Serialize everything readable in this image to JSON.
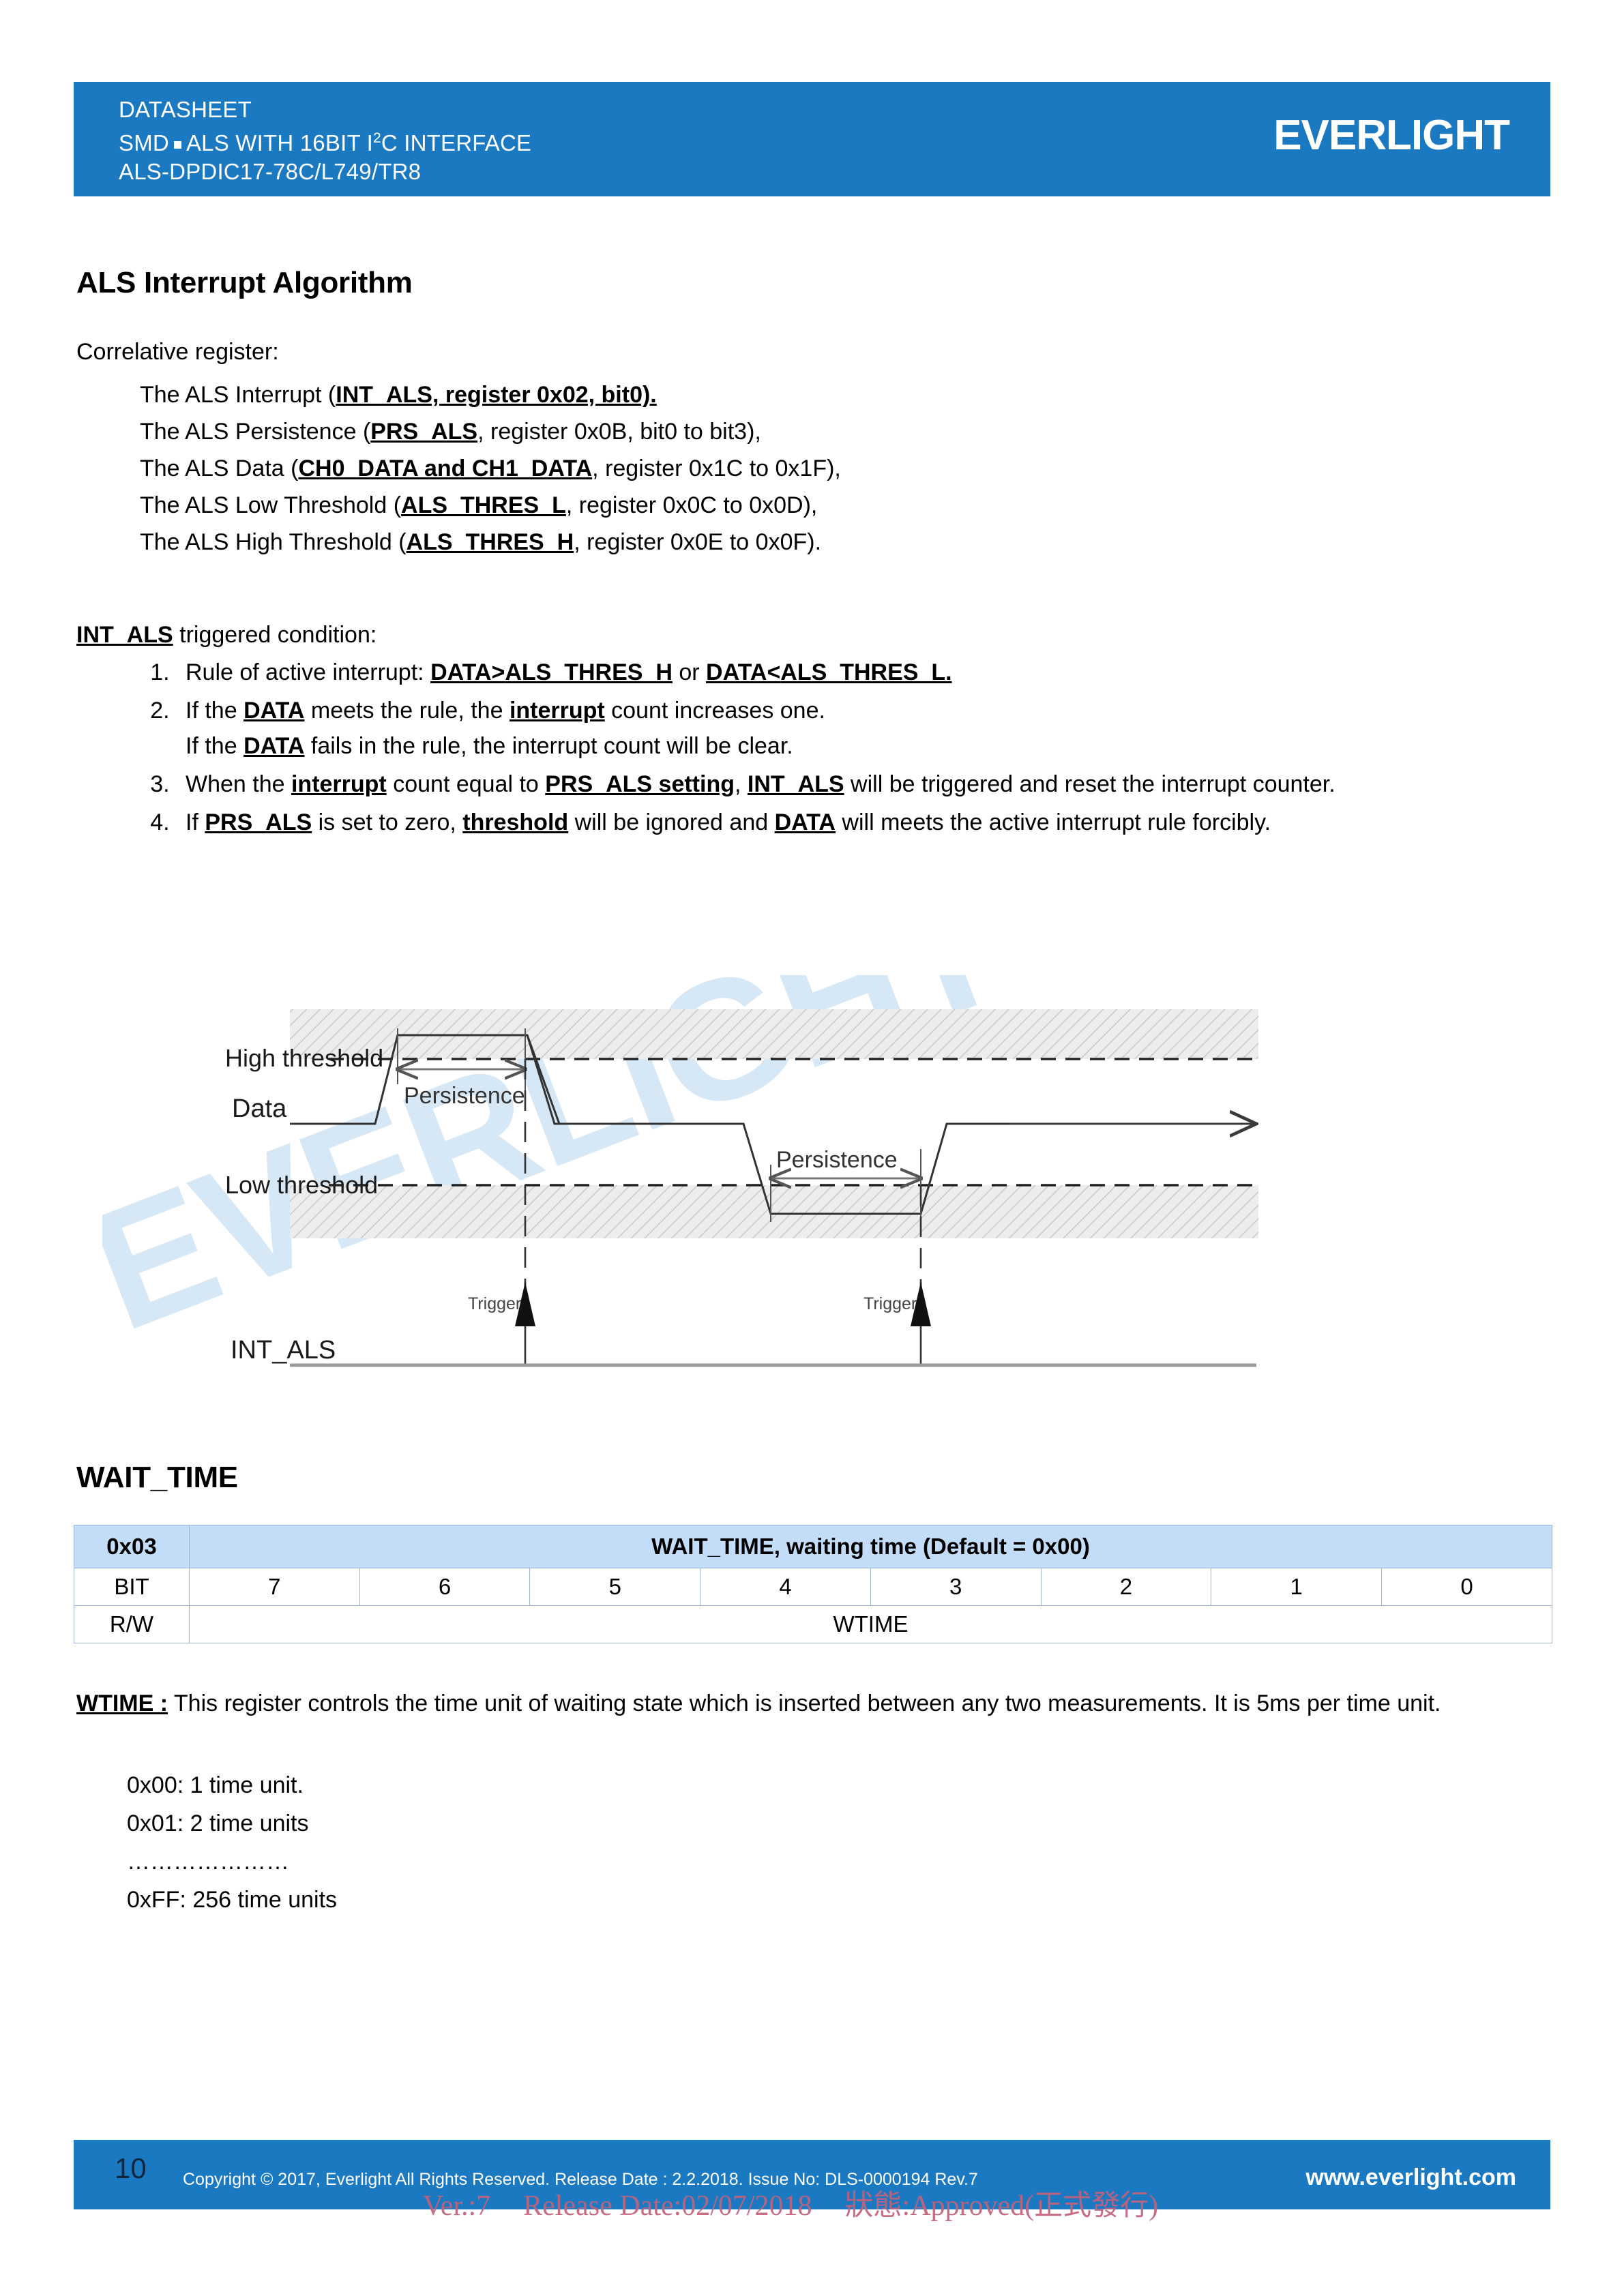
{
  "header": {
    "line1": "DATASHEET",
    "line2_pre": "SMD",
    "line2_mid": "ALS WITH 16BIT I",
    "line2_sup": "2",
    "line2_post": "C INTERFACE",
    "line3": "ALS-DPDIC17-78C/L749/TR8",
    "brand": "EVERLIGHT",
    "bar_color": "#1b79c2"
  },
  "body": {
    "als_section_title": "ALS Interrupt Algorithm",
    "correlative_label": "Correlative register:",
    "registers": [
      {
        "prefix": "The ALS Interrupt (",
        "bold": "INT_ALS, register 0x02, bit0).",
        "suffix": ""
      },
      {
        "prefix": "The ALS Persistence (",
        "bold": "PRS_ALS",
        "suffix": ", register 0x0B, bit0 to bit3),"
      },
      {
        "prefix": "The ALS Data (",
        "bold": "CH0_DATA and CH1_DATA",
        "suffix": ", register 0x1C to 0x1F),"
      },
      {
        "prefix": "The ALS Low Threshold (",
        "bold": "ALS_THRES_L",
        "suffix": ", register 0x0C to 0x0D),"
      },
      {
        "prefix": "The ALS High Threshold (",
        "bold": "ALS_THRES_H",
        "suffix": ", register 0x0E to 0x0F)."
      }
    ],
    "triggered_condition_bold": "INT_ALS",
    "triggered_condition_rest": " triggered condition:",
    "rules": [
      {
        "parts": [
          {
            "t": "Rule of active interrupt: ",
            "s": "plain"
          },
          {
            "t": "DATA",
            "s": "bu"
          },
          {
            "t": ">",
            "s": "bu"
          },
          {
            "t": "ALS_THRES_H",
            "s": "bu"
          },
          {
            "t": " or ",
            "s": "plain"
          },
          {
            "t": "DATA",
            "s": "bu"
          },
          {
            "t": "<",
            "s": "bu"
          },
          {
            "t": "ALS_THRES_L.",
            "s": "bu"
          }
        ]
      },
      {
        "parts": [
          {
            "t": "If the ",
            "s": "plain"
          },
          {
            "t": "DATA",
            "s": "bu"
          },
          {
            "t": " meets the rule, the ",
            "s": "plain"
          },
          {
            "t": "interrupt",
            "s": "bu"
          },
          {
            "t": " count increases one.",
            "s": "plain"
          },
          {
            "t": "BR",
            "s": "br"
          },
          {
            "t": "If the ",
            "s": "plain"
          },
          {
            "t": "DATA",
            "s": "bu"
          },
          {
            "t": " fails in the rule, the interrupt count will be clear.",
            "s": "plain"
          }
        ]
      },
      {
        "parts": [
          {
            "t": "When the ",
            "s": "plain"
          },
          {
            "t": "interrupt",
            "s": "bu"
          },
          {
            "t": " count equal to ",
            "s": "plain"
          },
          {
            "t": "PRS_ALS setting",
            "s": "bu"
          },
          {
            "t": ", ",
            "s": "plain"
          },
          {
            "t": "INT_ALS",
            "s": "bu"
          },
          {
            "t": " will be triggered and reset the interrupt counter.",
            "s": "plain"
          }
        ]
      },
      {
        "parts": [
          {
            "t": "If ",
            "s": "plain"
          },
          {
            "t": "PRS_ALS",
            "s": "bu"
          },
          {
            "t": " is set to zero, ",
            "s": "plain"
          },
          {
            "t": "threshold",
            "s": "bu"
          },
          {
            "t": " will be ignored and ",
            "s": "plain"
          },
          {
            "t": "DATA",
            "s": "bu"
          },
          {
            "t": " will meets the active interrupt rule forcibly.",
            "s": "plain"
          }
        ]
      }
    ]
  },
  "diagram": {
    "labels": {
      "high_threshold": "High threshold",
      "low_threshold": "Low threshold",
      "data": "Data",
      "int_als": "INT_ALS",
      "persistence_1": "Persistence",
      "persistence_2": "Persistence",
      "trigger_1": "Trigger",
      "trigger_2": "Trigger"
    },
    "band_fill": "#ededed",
    "hatch_color": "#c9c9c9"
  },
  "wait_time": {
    "section_title": "WAIT_TIME",
    "table": {
      "address": "0x03",
      "title": "WAIT_TIME, waiting time (Default = 0x00)",
      "bit_row_label": "BIT",
      "bits": [
        "7",
        "6",
        "5",
        "4",
        "3",
        "2",
        "1",
        "0"
      ],
      "rw_row_label": "R/W",
      "rw_value": "WTIME",
      "header_fill": "#c3dcf7"
    },
    "desc_bold": "WTIME :",
    "desc_text": " This register controls the time unit of waiting state which is inserted between any two measurements. It is 5ms per time unit.",
    "values": [
      "0x00: 1 time unit.",
      "0x01: 2 time units",
      "…………………",
      "0xFF: 256 time units"
    ]
  },
  "watermark": {
    "text": "EVERLIGHT"
  },
  "footer": {
    "page_number": "10",
    "copyright": "Copyright © 2017, Everlight All Rights Reserved. Release Date : 2.2.2018. Issue No: DLS-0000194 Rev.7",
    "url": "www.everlight.com",
    "bar_color": "#1b79c2",
    "stamp_ver": "Ver.:7",
    "stamp_date": "Release Date:02/07/2018",
    "stamp_status": "狀態:Approved(正式發行)"
  }
}
